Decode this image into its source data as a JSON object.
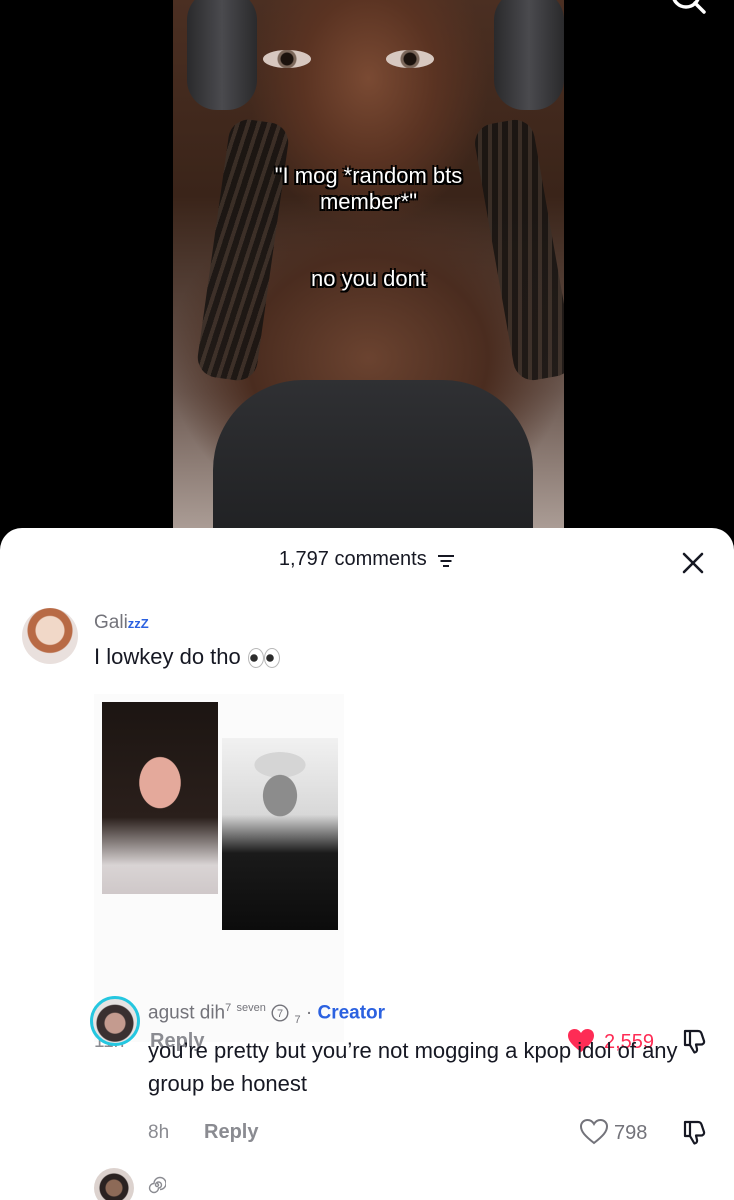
{
  "video": {
    "overlay_line_1": "\"I mog *random bts",
    "overlay_line_2": "member*\"",
    "overlay_line_3": "no you dont"
  },
  "sheet": {
    "comments_count": "1,797 comments",
    "close_icon": "close-icon",
    "filter_icon": "filter-icon"
  },
  "comments": [
    {
      "username": "Gali",
      "username_suffix": "zzZ",
      "text": "I lowkey do tho",
      "emoji": "eyes",
      "time": "11h",
      "reply_label": "Reply",
      "likes": "2,559",
      "liked": true,
      "has_image": true
    },
    {
      "username": "agust dih",
      "username_sup": "7",
      "username_tag": "seven",
      "badge_number": "7",
      "badge_sub": "7",
      "separator": "·",
      "creator_label": "Creator",
      "text": "you’re pretty but you’re not mogging a kpop idol of any group be honest",
      "time": "8h",
      "reply_label": "Reply",
      "likes": "798",
      "liked": false
    }
  ],
  "colors": {
    "accent_blue": "#2b61e0",
    "like_red": "#fe2c55",
    "creator_ring": "#25c7e0",
    "muted_text": "#73737a"
  }
}
